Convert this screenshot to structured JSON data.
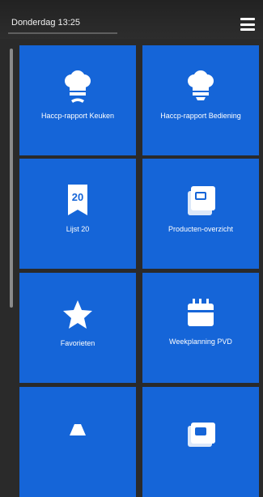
{
  "header": {
    "title": "Donderdag 13:25",
    "menu_icon": "hamburger-menu-icon"
  },
  "tiles": [
    {
      "label": "Haccp-rapport Keuken",
      "icon": "chef-hat-icon"
    },
    {
      "label": "Haccp-rapport Bediening",
      "icon": "chef-hat-icon"
    },
    {
      "label": "Lijst 20",
      "icon": "calendar-badge-20-icon"
    },
    {
      "label": "Producten-overzicht",
      "icon": "product-stack-icon"
    },
    {
      "label": "Favorieten",
      "icon": "star-icon"
    },
    {
      "label": "Weekplanning PVD",
      "icon": "calendar-icon"
    },
    {
      "label": "",
      "icon": "tile-icon"
    },
    {
      "label": "",
      "icon": "product-stack-icon"
    }
  ],
  "colors": {
    "background": "#2a2a2a",
    "tile": "#1565d8",
    "header": "#222222",
    "text": "#ffffff"
  }
}
